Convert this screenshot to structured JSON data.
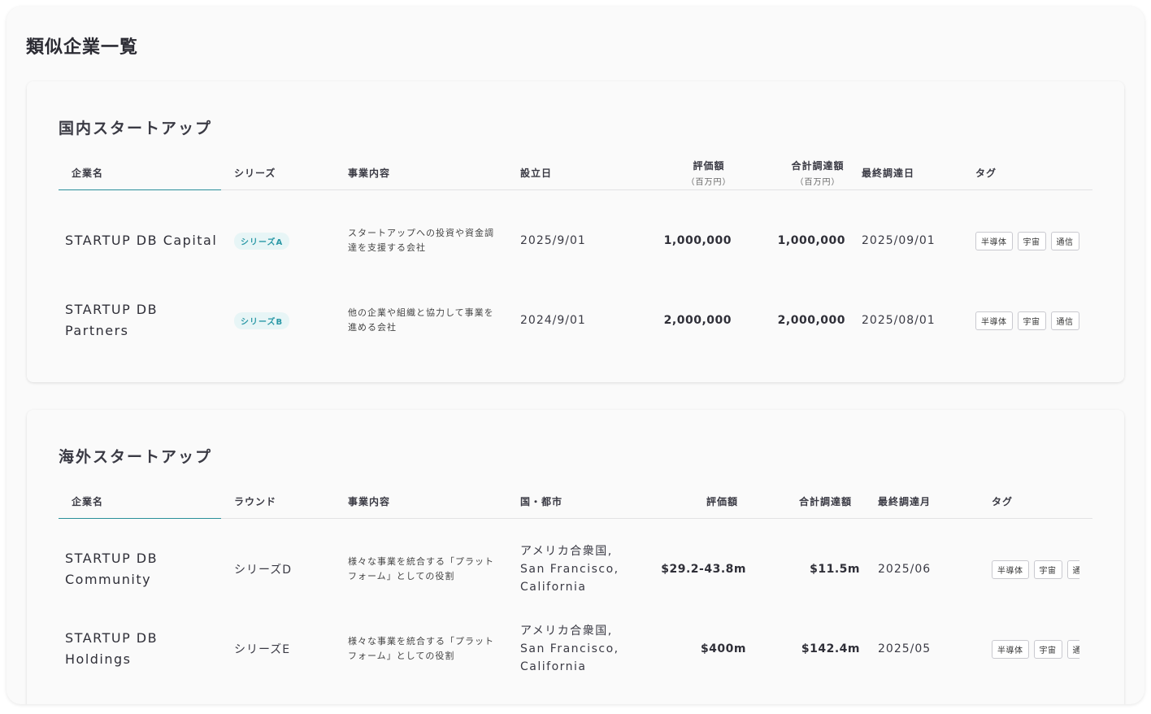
{
  "page": {
    "title": "類似企業一覧"
  },
  "domestic": {
    "title": "国内スタートアップ",
    "headers": {
      "company": "企業名",
      "series": "シリーズ",
      "business": "事業内容",
      "founded": "設立日",
      "valuation": "評価額",
      "valuation_unit": "（百万円）",
      "total_funding": "合計調達額",
      "total_funding_unit": "（百万円）",
      "last_funding": "最終調達日",
      "tags": "タグ"
    },
    "rows": [
      {
        "company": "STARTUP DB Capital",
        "series": "シリーズA",
        "business": "スタートアップへの投資や資金調達を支援する会社",
        "founded": "2025/9/01",
        "valuation": "1,000,000",
        "total_funding": "1,000,000",
        "last_funding": "2025/09/01",
        "tags": [
          "半導体",
          "宇宙",
          "通信"
        ]
      },
      {
        "company": "STARTUP DB Partners",
        "series": "シリーズB",
        "business": "他の企業や組織と協力して事業を進める会社",
        "founded": "2024/9/01",
        "valuation": "2,000,000",
        "total_funding": "2,000,000",
        "last_funding": "2025/08/01",
        "tags": [
          "半導体",
          "宇宙",
          "通信"
        ]
      }
    ]
  },
  "overseas": {
    "title": "海外スタートアップ",
    "headers": {
      "company": "企業名",
      "round": "ラウンド",
      "business": "事業内容",
      "location": "国・都市",
      "valuation": "評価額",
      "total_funding": "合計調達額",
      "last_funding": "最終調達月",
      "tags": "タグ"
    },
    "rows": [
      {
        "company": "STARTUP DB Community",
        "round": "シリーズD",
        "business": "様々な事業を統合する「プラットフォーム」としての役割",
        "location": "アメリカ合衆国, San Francisco, California",
        "valuation": "$29.2-43.8m",
        "total_funding": "$11.5m",
        "last_funding": "2025/06",
        "tags": [
          "半導体",
          "宇宙",
          "通信"
        ]
      },
      {
        "company": "STARTUP DB Holdings",
        "round": "シリーズE",
        "business": "様々な事業を統合する「プラットフォーム」としての役割",
        "location": "アメリカ合衆国, San Francisco, California",
        "valuation": "$400m",
        "total_funding": "$142.4m",
        "last_funding": "2025/05",
        "tags": [
          "半導体",
          "宇宙",
          "通信"
        ]
      }
    ]
  },
  "colors": {
    "accent": "#2a8f9a",
    "badge_bg": "#e7f5f6",
    "badge_text": "#2a98a6"
  }
}
